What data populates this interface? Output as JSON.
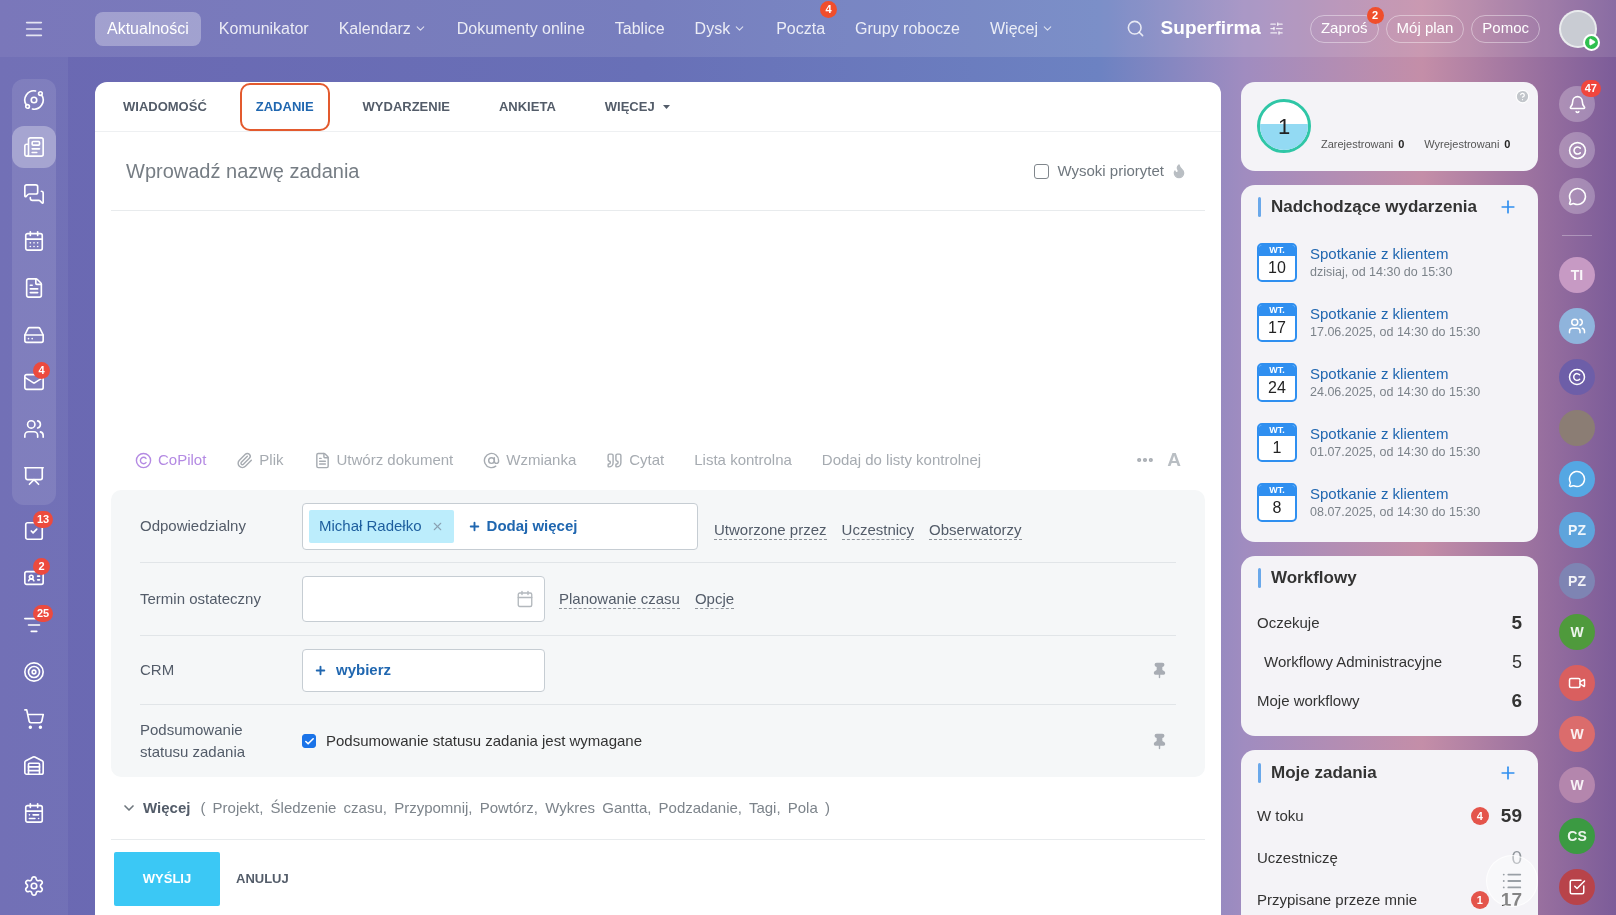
{
  "topbar": {
    "nav": [
      {
        "label": "Aktualności",
        "selected": true
      },
      {
        "label": "Komunikator",
        "selected": false
      },
      {
        "label": "Kalendarz",
        "selected": false,
        "dropdown": true
      },
      {
        "label": "Dokumenty online",
        "selected": false
      },
      {
        "label": "Tablice",
        "selected": false
      },
      {
        "label": "Dysk",
        "selected": false,
        "dropdown": true
      },
      {
        "label": "Poczta",
        "selected": false,
        "badge": "4"
      },
      {
        "label": "Grupy robocze",
        "selected": false
      },
      {
        "label": "Więcej",
        "selected": false,
        "dropdown": true
      }
    ],
    "company": "Superfirma",
    "buttons": [
      {
        "label": "Zaproś",
        "badge": "2"
      },
      {
        "label": "Mój plan"
      },
      {
        "label": "Pomoc"
      }
    ]
  },
  "sidebar": {
    "pinned": [
      {
        "kind": "orbit",
        "selected": false
      },
      {
        "kind": "news",
        "selected": true
      },
      {
        "kind": "chats",
        "selected": false
      },
      {
        "kind": "calendar",
        "selected": false
      },
      {
        "kind": "document",
        "selected": false
      },
      {
        "kind": "drive",
        "selected": false
      },
      {
        "kind": "mail",
        "selected": false,
        "badge": "4"
      },
      {
        "kind": "people",
        "selected": false
      },
      {
        "kind": "board",
        "selected": false
      }
    ],
    "items": [
      {
        "kind": "tasks",
        "selected": false,
        "badge": "13"
      },
      {
        "kind": "contacts",
        "selected": false,
        "badge": "2"
      },
      {
        "kind": "funnel",
        "selected": false,
        "badge": "25"
      },
      {
        "kind": "target",
        "selected": false
      },
      {
        "kind": "cart",
        "selected": false
      },
      {
        "kind": "warehouse",
        "selected": false
      },
      {
        "kind": "schedule",
        "selected": false
      }
    ],
    "footer": {
      "kind": "settings",
      "selected": false
    }
  },
  "composer": {
    "tabs": [
      {
        "label": "WIADOMOŚĆ",
        "selected": false
      },
      {
        "label": "ZADANIE",
        "selected": true
      },
      {
        "label": "WYDARZENIE",
        "selected": false
      },
      {
        "label": "ANKIETA",
        "selected": false
      },
      {
        "label": "WIĘCEJ",
        "selected": false,
        "dropdown": true
      }
    ],
    "title_field": {
      "placeholder": "Wprowadź nazwę zadania"
    },
    "priority": {
      "label": "Wysoki priorytet",
      "checked": false
    },
    "toolbar": [
      {
        "kind": "copilot",
        "label": "CoPilot"
      },
      {
        "kind": "file",
        "label": "Plik"
      },
      {
        "kind": "document",
        "label": "Utwórz dokument"
      },
      {
        "kind": "mention",
        "label": "Wzmianka"
      },
      {
        "kind": "quote",
        "label": "Cytat"
      },
      {
        "kind": "text",
        "label": "Lista kontrolna"
      },
      {
        "kind": "text",
        "label": "Dodaj do listy kontrolnej"
      }
    ],
    "toolbar_format": "A",
    "fields": [
      {
        "kind": "people",
        "label": "Odpowiedzialny",
        "chips": [
          "Michał Radełko"
        ],
        "add": "Dodaj więcej",
        "links": [
          "Utworzone przez",
          "Uczestnicy",
          "Obserwatorzy"
        ]
      },
      {
        "kind": "date",
        "label": "Termin ostateczny",
        "links": [
          "Planowanie czasu",
          "Opcje"
        ]
      },
      {
        "kind": "picker",
        "label": "CRM",
        "add": "wybierz",
        "pin": true
      },
      {
        "kind": "checkbox",
        "label": "Podsumowanie statusu zadania",
        "option": "Podsumowanie statusu zadania jest wymagane",
        "checked": true,
        "pin": true
      }
    ],
    "more": {
      "label": "Więcej",
      "items": "( Projekt, Śledzenie czasu, Przypomnij, Powtórz, Wykres Gantta, Podzadanie, Tagi, Pola )"
    },
    "actions": [
      {
        "kind": "primary",
        "label": "WYŚLIJ"
      },
      {
        "kind": "plain",
        "label": "ANULUJ"
      }
    ]
  },
  "stats": {
    "value": "1",
    "items": [
      {
        "label": "Zarejestrowani",
        "value": "0"
      },
      {
        "label": "Wyrejestrowani",
        "value": "0"
      }
    ]
  },
  "events": {
    "title": "Nadchodzące wydarzenia",
    "items": [
      {
        "weekday": "WT.",
        "day": "10",
        "title": "Spotkanie z klientem",
        "time": "dzisiaj, od 14:30 do 15:30"
      },
      {
        "weekday": "WT.",
        "day": "17",
        "title": "Spotkanie z klientem",
        "time": "17.06.2025, od 14:30 do 15:30"
      },
      {
        "weekday": "WT.",
        "day": "24",
        "title": "Spotkanie z klientem",
        "time": "24.06.2025, od 14:30 do 15:30"
      },
      {
        "weekday": "WT.",
        "day": "1",
        "title": "Spotkanie z klientem",
        "time": "01.07.2025, od 14:30 do 15:30"
      },
      {
        "weekday": "WT.",
        "day": "8",
        "title": "Spotkanie z klientem",
        "time": "08.07.2025, od 14:30 do 15:30"
      }
    ]
  },
  "workflows": {
    "title": "Workflowy",
    "rows": [
      {
        "kind": "group",
        "label": "Oczekuje",
        "count": "5"
      },
      {
        "kind": "subgroup",
        "label": "Workflowy Administracyjne",
        "count": "5"
      },
      {
        "kind": "group",
        "label": "Moje workflowy",
        "count": "6"
      }
    ]
  },
  "tasks": {
    "title": "Moje zadania",
    "rows": [
      {
        "label": "W toku",
        "badge": "4",
        "count": "59",
        "dimmed": false
      },
      {
        "label": "Uczestniczę",
        "count": "0",
        "dimmed": true
      },
      {
        "label": "Przypisane przeze mnie",
        "badge": "1",
        "count": "17",
        "dimmed": false
      }
    ]
  },
  "rail": {
    "tools": [
      {
        "kind": "bell",
        "badge": "47"
      },
      {
        "kind": "copilot"
      },
      {
        "kind": "chat"
      }
    ],
    "contacts": [
      {
        "kind": "initials",
        "text": "TI",
        "color": "#c79ac4"
      },
      {
        "kind": "group",
        "color": "#8fb4dc"
      },
      {
        "kind": "copilot",
        "color": "#6d5ea8"
      },
      {
        "kind": "photo",
        "color": "#8b7d74"
      },
      {
        "kind": "chat",
        "color": "#55a7e3"
      },
      {
        "kind": "initials",
        "text": "PZ",
        "color": "#5ea4dc"
      },
      {
        "kind": "initials",
        "text": "PZ",
        "color": "#7e84b3"
      },
      {
        "kind": "initials",
        "text": "W",
        "color": "#4f9a3c"
      },
      {
        "kind": "video",
        "color": "#d95f5f"
      },
      {
        "kind": "initials",
        "text": "W",
        "color": "#db6c6c"
      },
      {
        "kind": "initials",
        "text": "W",
        "color": "#b486ad"
      },
      {
        "kind": "initials",
        "text": "CS",
        "color": "#3b9a42"
      },
      {
        "kind": "tasks",
        "color": "#b8434a"
      }
    ]
  }
}
